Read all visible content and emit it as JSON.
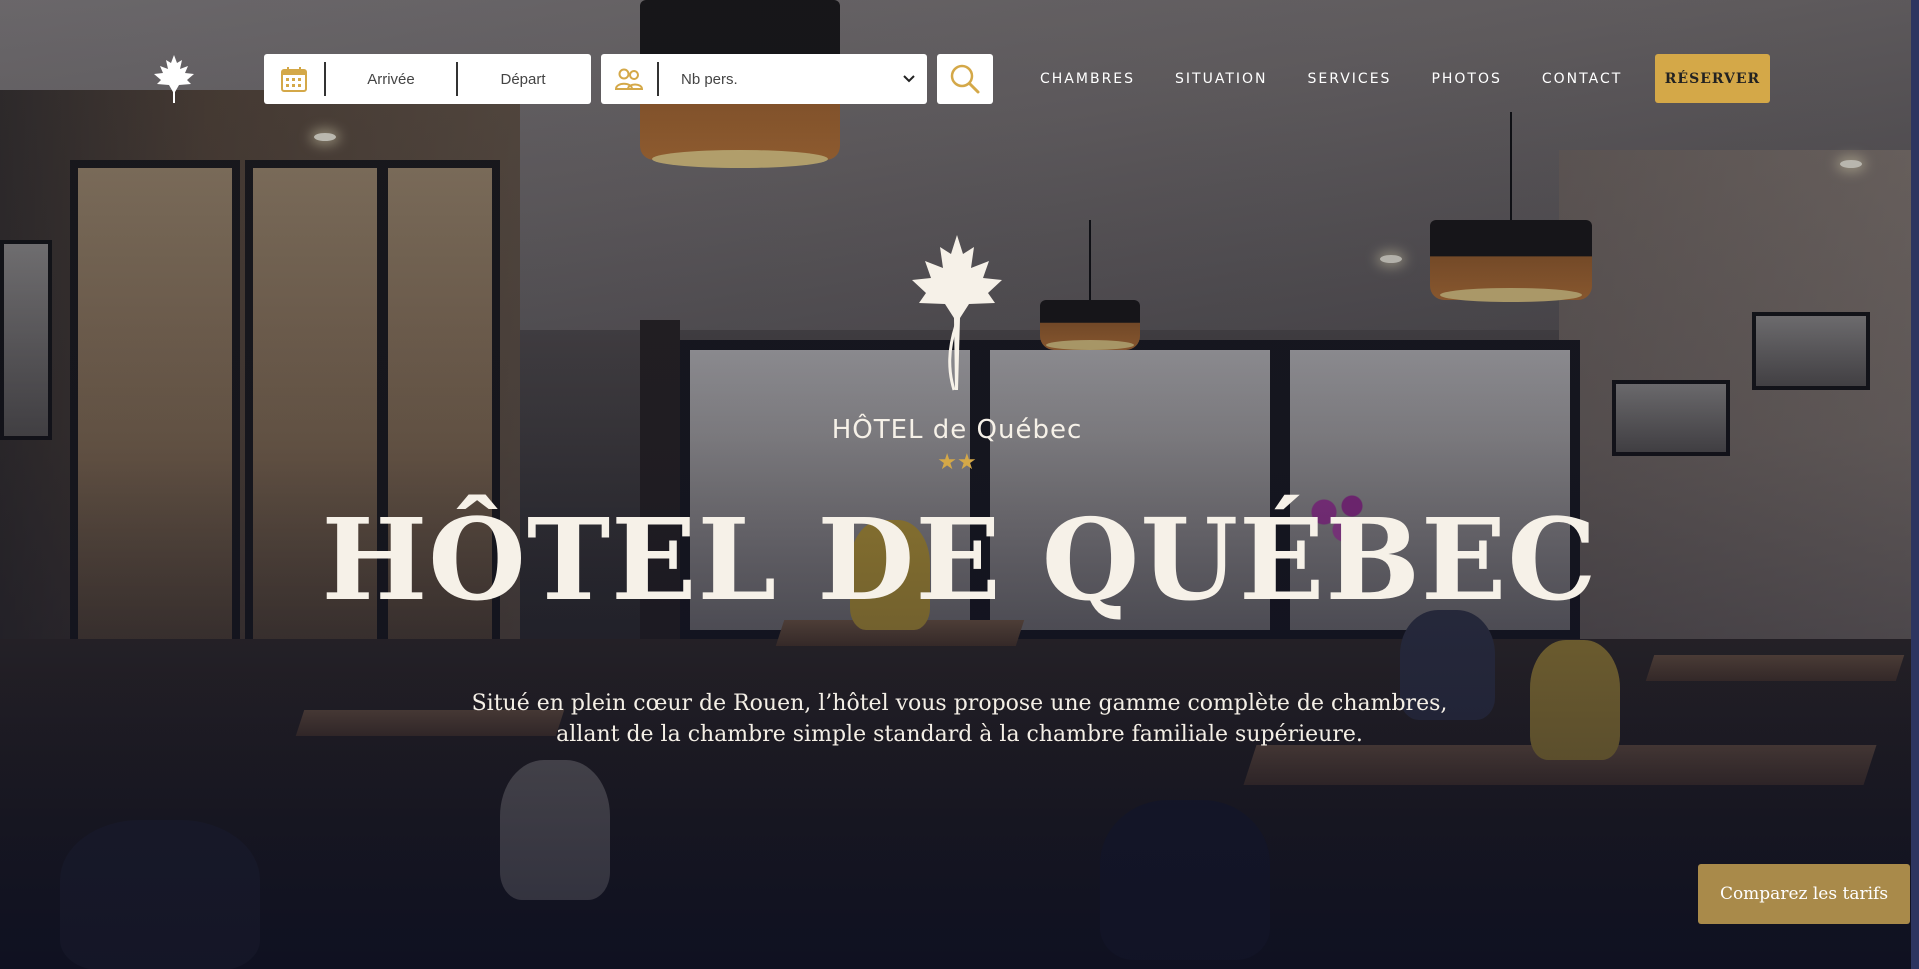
{
  "colors": {
    "accent": "#d4a848",
    "compare_button": "#a98a4a",
    "title_text": "#f6f1e8"
  },
  "header": {
    "brand_icon": "maple-leaf-icon",
    "booking": {
      "calendar_icon": "calendar-icon",
      "arrival_label": "Arrivée",
      "departure_label": "Départ",
      "guests_icon": "people-icon",
      "guests_selected": "Nb pers.",
      "search_icon": "search-icon"
    },
    "nav": [
      {
        "label": "CHAMBRES"
      },
      {
        "label": "SITUATION"
      },
      {
        "label": "SERVICES"
      },
      {
        "label": "PHOTOS"
      },
      {
        "label": "CONTACT"
      }
    ],
    "reserve_label": "RÉSERVER"
  },
  "hero": {
    "logo_text": "HÔTEL de Québec",
    "logo_stars": 2,
    "title": "HÔTEL DE QUÉBEC",
    "subtitle_line1": "Situé en plein cœur de Rouen, l’hôtel vous propose une gamme complète de chambres,",
    "subtitle_line2": "allant de la chambre simple standard à la chambre familiale supérieure."
  },
  "compare_label": "Comparez les tarifs"
}
